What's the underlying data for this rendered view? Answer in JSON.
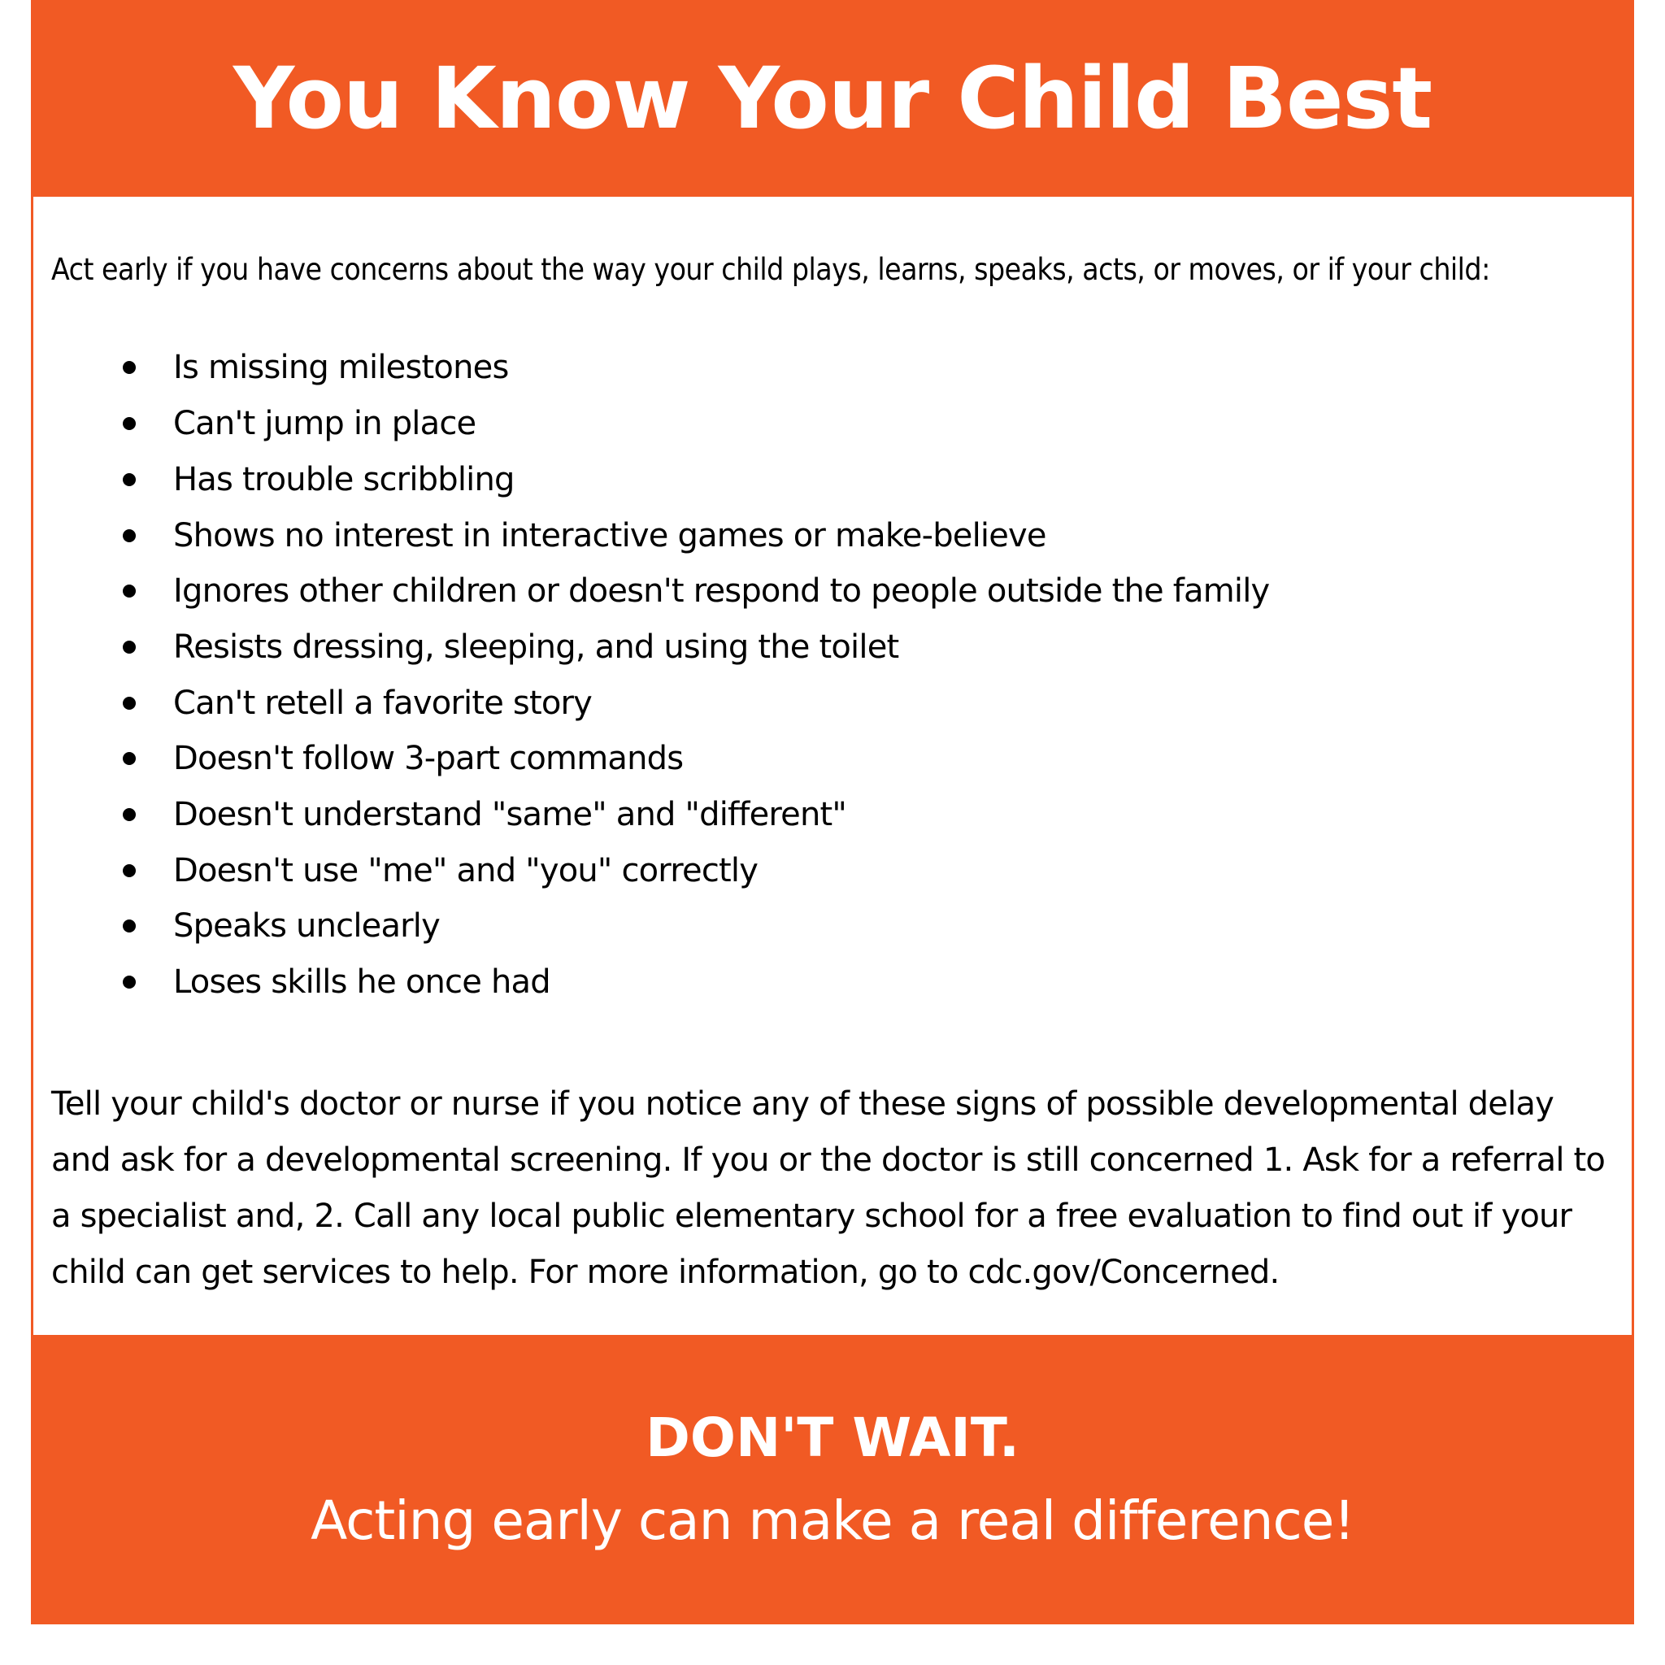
{
  "colors": {
    "accent": "#F15A24",
    "panel": "#FFFFFF",
    "text": "#000000",
    "on_accent_text": "#FFFFFF"
  },
  "header": {
    "title": "You Know Your Child Best"
  },
  "content": {
    "intro": "Act early if you have concerns about the way your child plays, learns, speaks, acts, or moves, or if your child:",
    "signs": [
      "Is missing milestones",
      "Can't jump in place",
      "Has trouble scribbling",
      "Shows no interest in interactive games or make-believe",
      "Ignores other children or doesn't respond to people outside the family",
      "Resists dressing, sleeping, and using the toilet",
      "Can't retell a favorite story",
      "Doesn't follow 3-part commands",
      "Doesn't understand \"same\" and \"different\"",
      "Doesn't use \"me\" and \"you\" correctly",
      "Speaks unclearly",
      "Loses skills he once had"
    ],
    "outro": "Tell your child's doctor or nurse if you notice any of these signs of possible developmental delay and ask for a developmental screening. If you or the doctor is still concerned 1. Ask for a referral to a specialist and, 2. Call any local public elementary school for a free evaluation to find out if your child can get services to help. For more information, go to cdc.gov/Concerned."
  },
  "footer": {
    "headline": "DON'T WAIT.",
    "tagline": "Acting early can make a real difference!"
  }
}
